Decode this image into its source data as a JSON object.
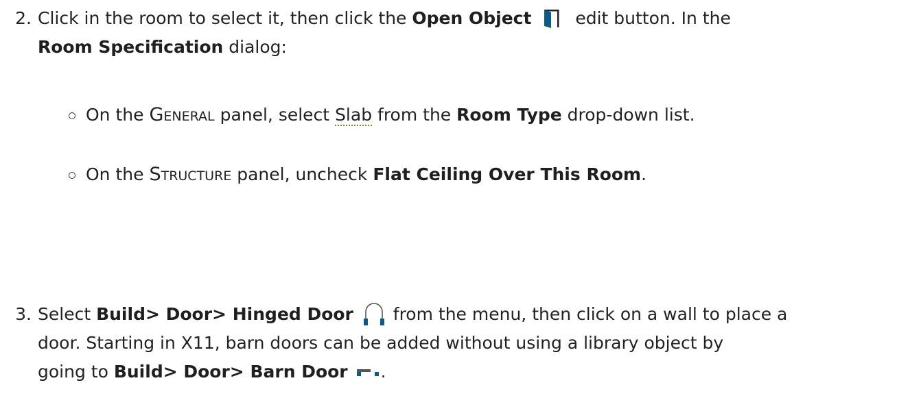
{
  "step2": {
    "number": "2.",
    "line1_a": "Click in the room to select it, then click the ",
    "line1_bold": "Open Object",
    "line1_b": " edit button. In the",
    "line2_bold": "Room Specification",
    "line2_b": " dialog:",
    "bullets": [
      {
        "a": "On the ",
        "panel": "General",
        "b": " panel, select ",
        "term": "Slab",
        "c": " from the ",
        "bold": "Room Type",
        "d": " drop-down list."
      },
      {
        "a": "On the ",
        "panel": "Structure",
        "b": " panel, uncheck ",
        "bold": "Flat Ceiling Over This Room",
        "c": "."
      }
    ],
    "icon": "open-object-icon"
  },
  "step3": {
    "number": "3.",
    "line1_a": "Select ",
    "line1_bold": "Build> Door> Hinged Door",
    "line1_b": " from the menu, then click on a wall to place a",
    "line2": "door. Starting in X11, barn doors can be added without using a library object by",
    "line3_a": "going to ",
    "line3_bold": "Build> Door> Barn Door",
    "line3_b": ".",
    "icons": [
      "hinged-door-icon",
      "barn-door-icon"
    ]
  },
  "colors": {
    "text": "#222222",
    "icon_blue": "#0b5a8c",
    "dotted_underline": "#6a8c3a"
  }
}
